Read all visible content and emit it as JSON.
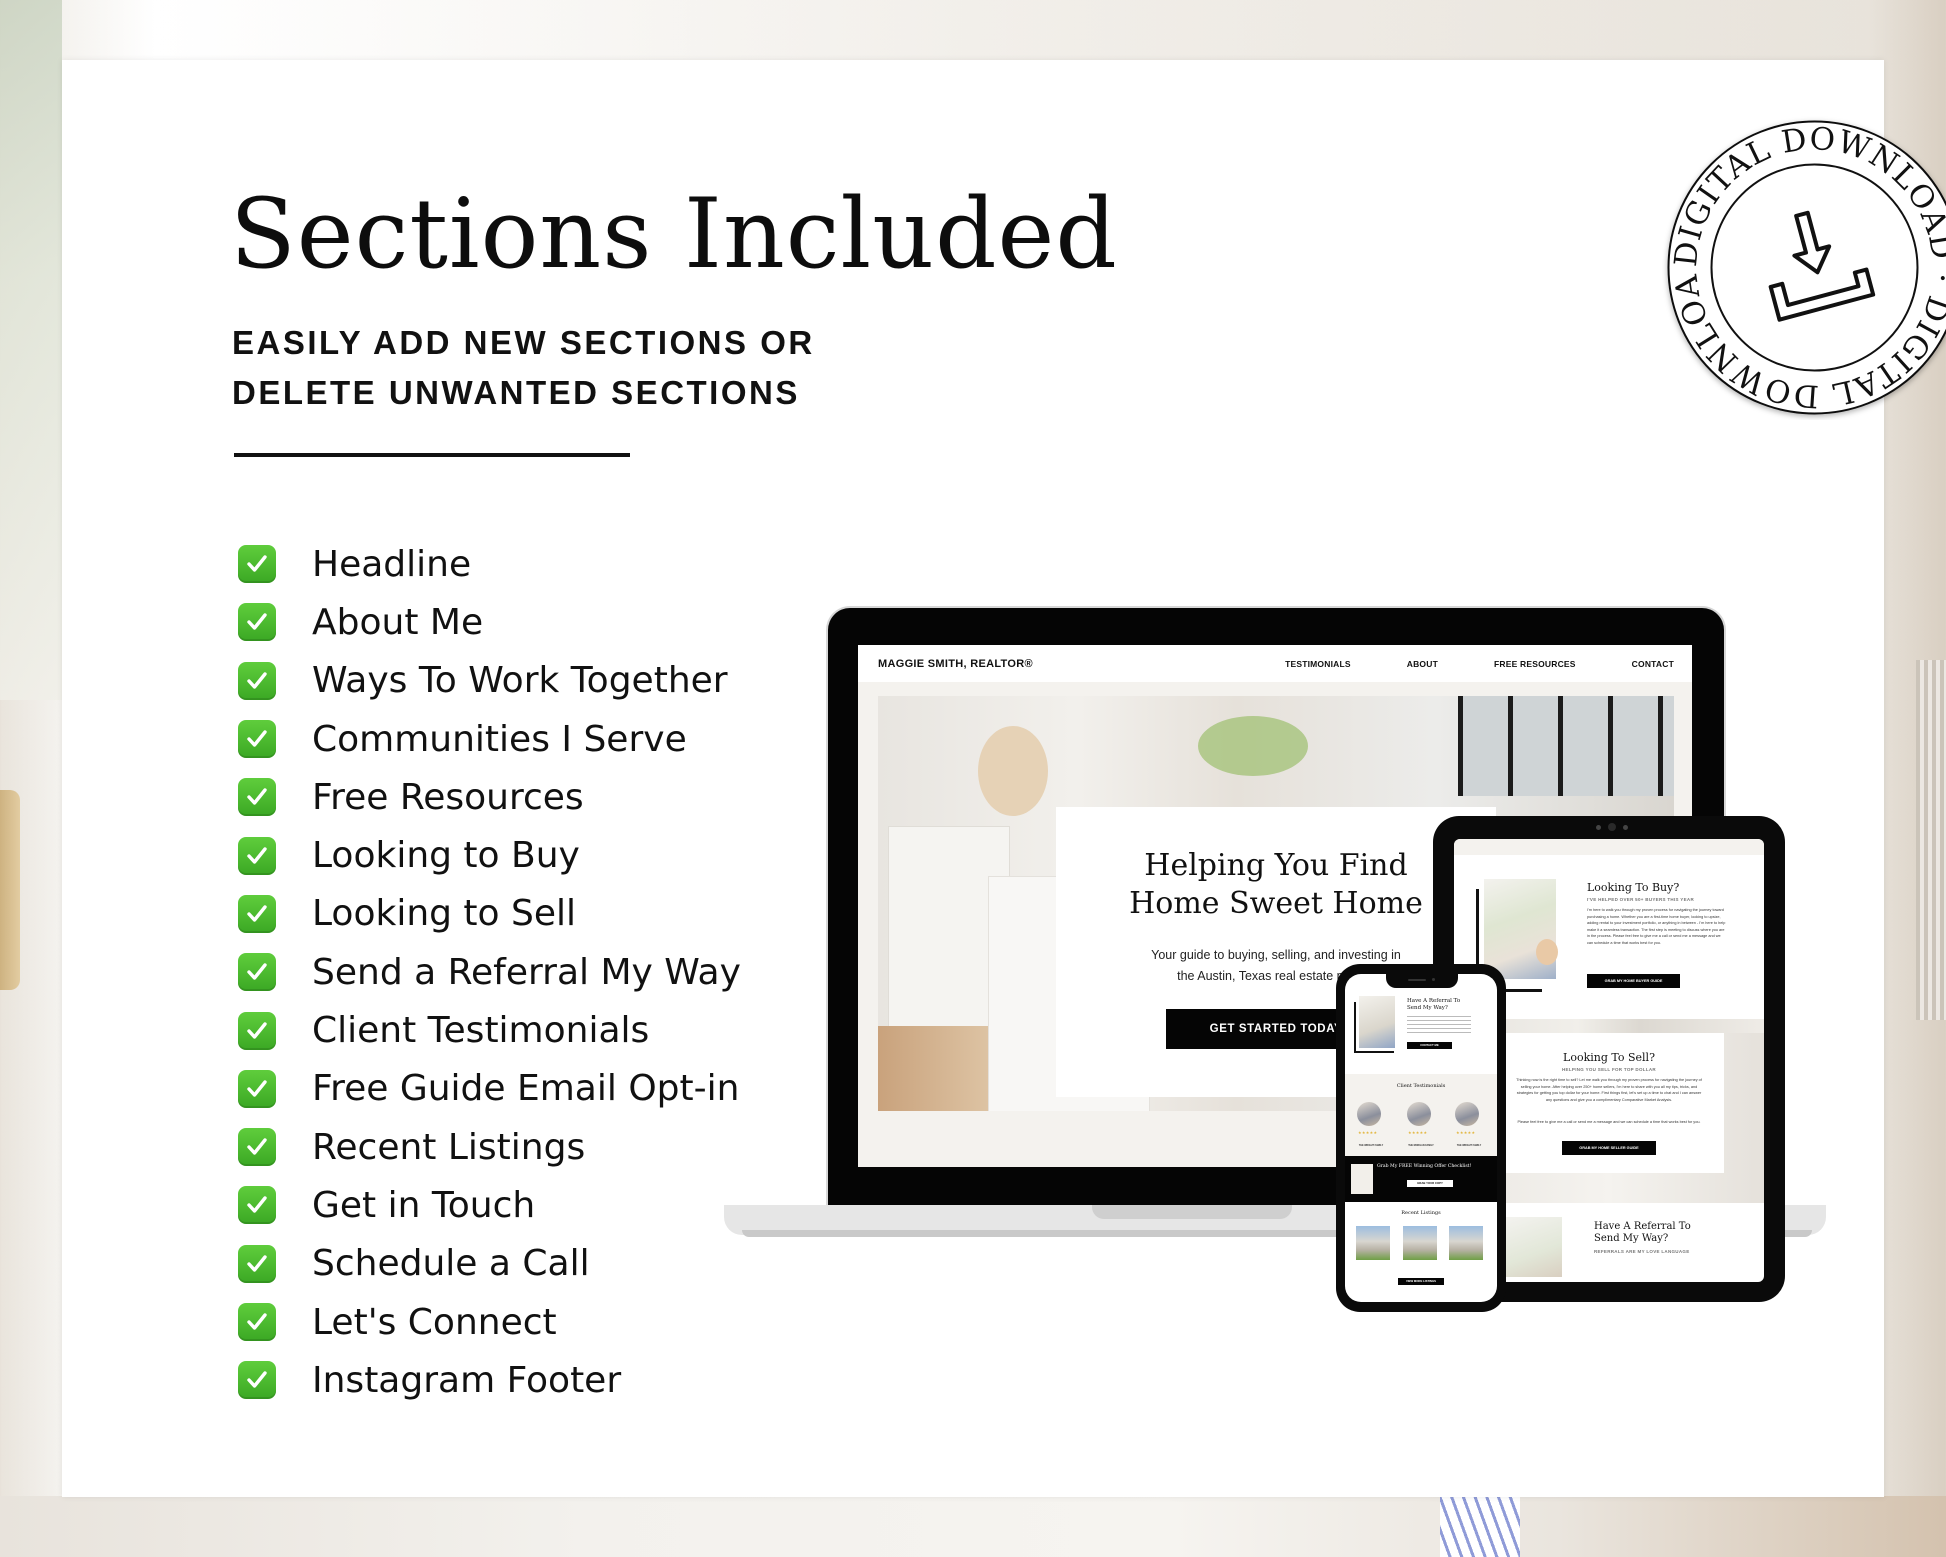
{
  "header": {
    "title": "Sections Included",
    "subtitle_line1": "EASILY ADD NEW SECTIONS OR",
    "subtitle_line2": "DELETE UNWANTED SECTIONS"
  },
  "sections": [
    "Headline",
    "About Me",
    "Ways To Work Together",
    "Communities I Serve",
    "Free Resources",
    "Looking to Buy",
    "Looking to Sell",
    "Send a Referral My Way",
    "Client Testimonials",
    "Free Guide Email Opt-in",
    "Recent Listings",
    "Get in Touch",
    "Schedule a Call",
    "Let's Connect",
    "Instagram Footer"
  ],
  "check_icon": "white-check-mark-on-green",
  "badge": {
    "text": "DIGITAL DOWNLOAD · DIGITAL DOWNLOAD ·",
    "icon": "download-icon"
  },
  "laptop": {
    "brand": "MAGGIE SMITH, REALTOR®",
    "nav": [
      "TESTIMONIALS",
      "ABOUT",
      "FREE RESOURCES",
      "CONTACT"
    ],
    "hero_title_line1": "Helping You Find",
    "hero_title_line2": "Home Sweet Home",
    "hero_text_line1": "Your guide to buying, selling, and investing in",
    "hero_text_line2": "the Austin, Texas real estate market",
    "hero_button": "GET STARTED TODAY"
  },
  "tablet": {
    "buy_title": "Looking To Buy?",
    "buy_sub": "I'VE HELPED OVER 50+ BUYERS THIS YEAR",
    "buy_text": "I'm here to walk you through my proven process for navigating the journey toward purchasing a home. Whether you are a first-time home buyer, looking to upsize, adding rental to your investment portfolio, or anything in between - I'm here to help make it a seamless transaction. The first step is meeting to discuss where you are in the process. Please feel free to give me a call or send me a message and we can schedule a time that works best for you.",
    "buy_button": "GRAB MY HOME BUYER GUIDE",
    "sell_title": "Looking To Sell?",
    "sell_sub": "HELPING YOU SELL FOR TOP DOLLAR",
    "sell_text": "Thinking now is the right time to sell? Let me walk you through my proven process for navigating the journey of selling your home. After helping over 250+ home sellers, I'm here to share with you all my tips, tricks, and strategies for getting you top dollar for your home. First things first, let's set up a time to chat and I can answer any questions and give you a complimentary Comparative Market Analysis.",
    "sell_text2": "Please feel free to give me a call or send me a message and we can schedule a time that works best for you.",
    "sell_button": "GRAB MY HOME SELLER GUIDE",
    "referral_title_line1": "Have A Referral To",
    "referral_title_line2": "Send My Way?",
    "referral_sub": "REFERRALS ARE MY LOVE LANGUAGE"
  },
  "phone": {
    "referral_title_line1": "Have A Referral To",
    "referral_title_line2": "Send My Way?",
    "referral_button": "CONTACT ME",
    "testimonials_title": "Client Testimonials",
    "stars": "★★★★★",
    "families": [
      "THE WRIGHT FAMILY",
      "THE MORGAN FAMILY",
      "THE WRIGHT FAMILY"
    ],
    "optin_title": "Grab My FREE Winning Offer Checklist!",
    "optin_button": "GRAB YOUR COPY",
    "listings_title": "Recent Listings",
    "listings_button": "VIEW MORE LISTINGS"
  }
}
